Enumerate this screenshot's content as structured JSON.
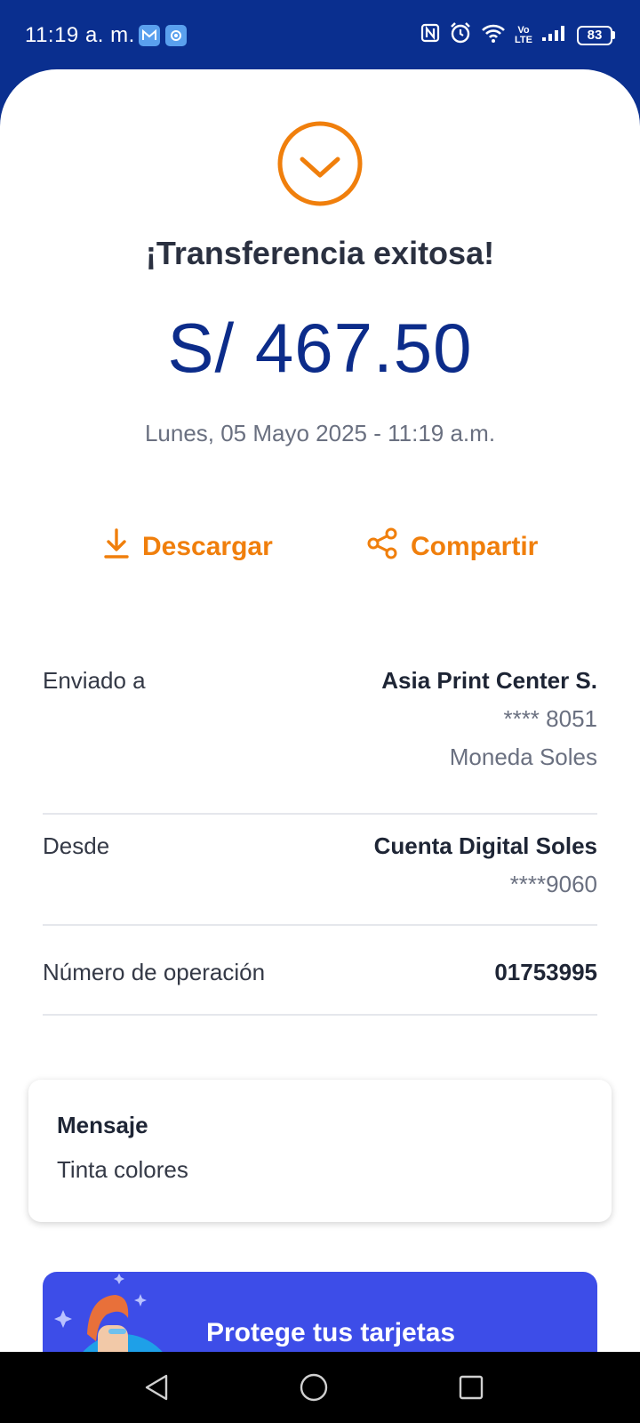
{
  "status_bar": {
    "time": "11:19 a. m.",
    "battery": "83",
    "lte_top": "Vo",
    "lte_bottom": "LTE",
    "icons": [
      "mail-icon",
      "shield-app-icon",
      "nfc-icon",
      "alarm-icon",
      "wifi-icon",
      "volte-icon",
      "signal-icon",
      "battery-icon"
    ]
  },
  "receipt": {
    "title": "¡Transferencia exitosa!",
    "amount": "S/ 467.50",
    "datetime": "Lunes, 05 Mayo 2025 - 11:19 a.m.",
    "success_icon": "check-circle-icon",
    "accent_color": "#f07f0c",
    "amount_color": "#0c2c8a"
  },
  "actions": {
    "download_label": "Descargar",
    "share_label": "Compartir"
  },
  "details": {
    "sent_to": {
      "label": "Enviado a",
      "name": "Asia Print Center S.",
      "account": "**** 8051",
      "currency": "Moneda Soles"
    },
    "from": {
      "label": "Desde",
      "account_name": "Cuenta Digital Soles",
      "account": "****9060"
    },
    "operation": {
      "label": "Número de operación",
      "value": "01753995"
    }
  },
  "message": {
    "title": "Mensaje",
    "text": "Tinta colores"
  },
  "promo": {
    "title": "Protege tus tarjetas",
    "color": "#3d4de8"
  },
  "nav": {
    "icons": [
      "back-icon",
      "home-icon",
      "recents-icon"
    ]
  }
}
